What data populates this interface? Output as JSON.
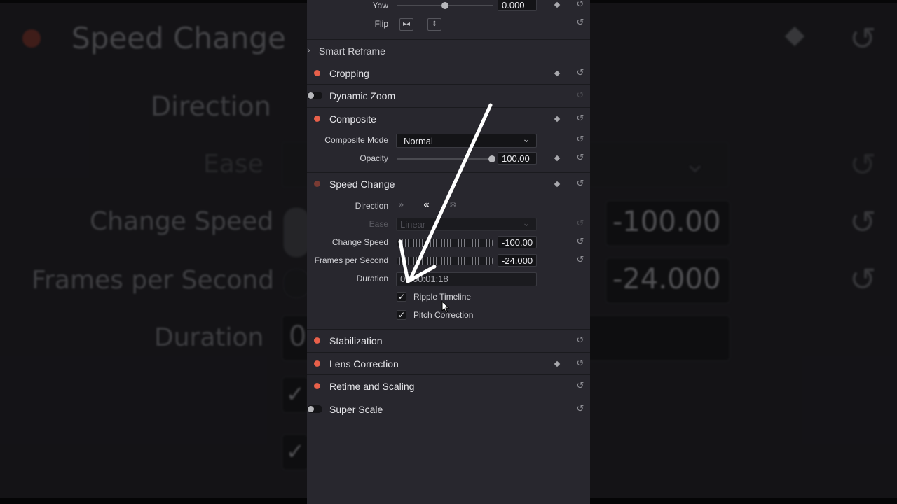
{
  "background": {
    "speed_change": "Speed Change",
    "direction": "Direction",
    "ease": "Ease",
    "change_speed": "Change Speed",
    "frames_per_second": "Frames per Second",
    "duration": "Duration",
    "change_speed_value": "-100.00",
    "fps_value": "-24.000",
    "duration_value_fragment": "0"
  },
  "transform": {
    "yaw_label": "Yaw",
    "yaw_value": "0.000",
    "flip_label": "Flip"
  },
  "smart_reframe": {
    "title": "Smart Reframe"
  },
  "cropping": {
    "title": "Cropping"
  },
  "dynamic_zoom": {
    "title": "Dynamic Zoom"
  },
  "composite": {
    "title": "Composite",
    "mode_label": "Composite Mode",
    "mode_value": "Normal",
    "opacity_label": "Opacity",
    "opacity_value": "100.00"
  },
  "speed_change": {
    "title": "Speed Change",
    "direction_label": "Direction",
    "ease_label": "Ease",
    "ease_value": "Linear",
    "change_speed_label": "Change Speed",
    "change_speed_value": "-100.00",
    "fps_label": "Frames per Second",
    "fps_value": "-24.000",
    "duration_label": "Duration",
    "duration_value": "00:00:01:18",
    "ripple_label": "Ripple Timeline",
    "pitch_label": "Pitch Correction",
    "ripple_checked": true,
    "pitch_checked": true
  },
  "stabilization": {
    "title": "Stabilization"
  },
  "lens_correction": {
    "title": "Lens Correction"
  },
  "retime_scaling": {
    "title": "Retime and Scaling"
  },
  "super_scale": {
    "title": "Super Scale"
  },
  "colors": {
    "enabled_dot": "#e8604a",
    "panel": "#28272e",
    "annotation_arrow": "#ffffff"
  },
  "icons": {
    "checkmark": "✓",
    "reset": "↺",
    "chevron_down": "⌄",
    "chevron_right": "›",
    "forward": "»",
    "reverse": "«",
    "freeze": "❄"
  }
}
